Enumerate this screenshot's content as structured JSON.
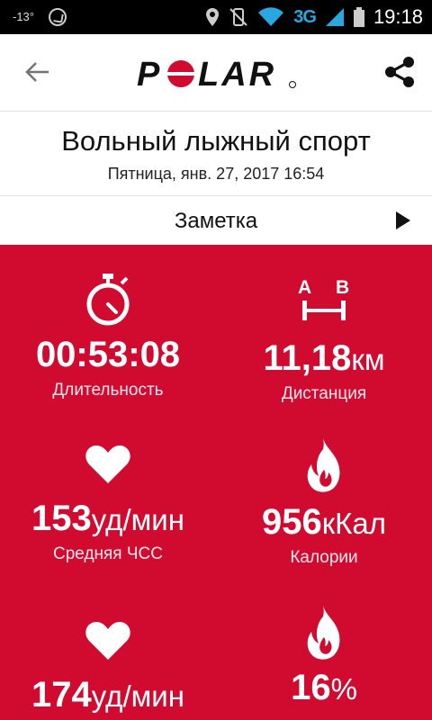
{
  "status_bar": {
    "temperature": "-13°",
    "network": "3G",
    "time": "19:18",
    "icons": [
      "whatsapp-icon",
      "location-icon",
      "mute-icon",
      "wifi-icon",
      "signal-icon",
      "battery-icon"
    ]
  },
  "app_bar": {
    "back_icon": "arrow-left-icon",
    "logo_text": "POLAR",
    "share_icon": "share-icon"
  },
  "session": {
    "title": "Вольный лыжный спорт",
    "date": "Пятница, янв. 27, 2017 16:54"
  },
  "note": {
    "label": "Заметка",
    "icon": "play-arrow-icon"
  },
  "stats": [
    {
      "icon": "stopwatch-icon",
      "value": "00:53:08",
      "unit": "",
      "label": "Длительность"
    },
    {
      "icon": "distance-icon",
      "value": "11,18",
      "unit": "км",
      "label": "Дистанция"
    },
    {
      "icon": "heart-icon",
      "value": "153",
      "unit": "уд/мин",
      "label": "Средняя ЧСС"
    },
    {
      "icon": "flame-icon",
      "value": "956",
      "unit": "кКал",
      "label": "Калории"
    },
    {
      "icon": "heart-icon",
      "value": "174",
      "unit": "уд/мин",
      "label": ""
    },
    {
      "icon": "flame-icon",
      "value": "16",
      "unit": "%",
      "label": ""
    }
  ],
  "colors": {
    "accent": "#d10a2f",
    "statusbar": "#000000",
    "network": "#29a7df"
  }
}
